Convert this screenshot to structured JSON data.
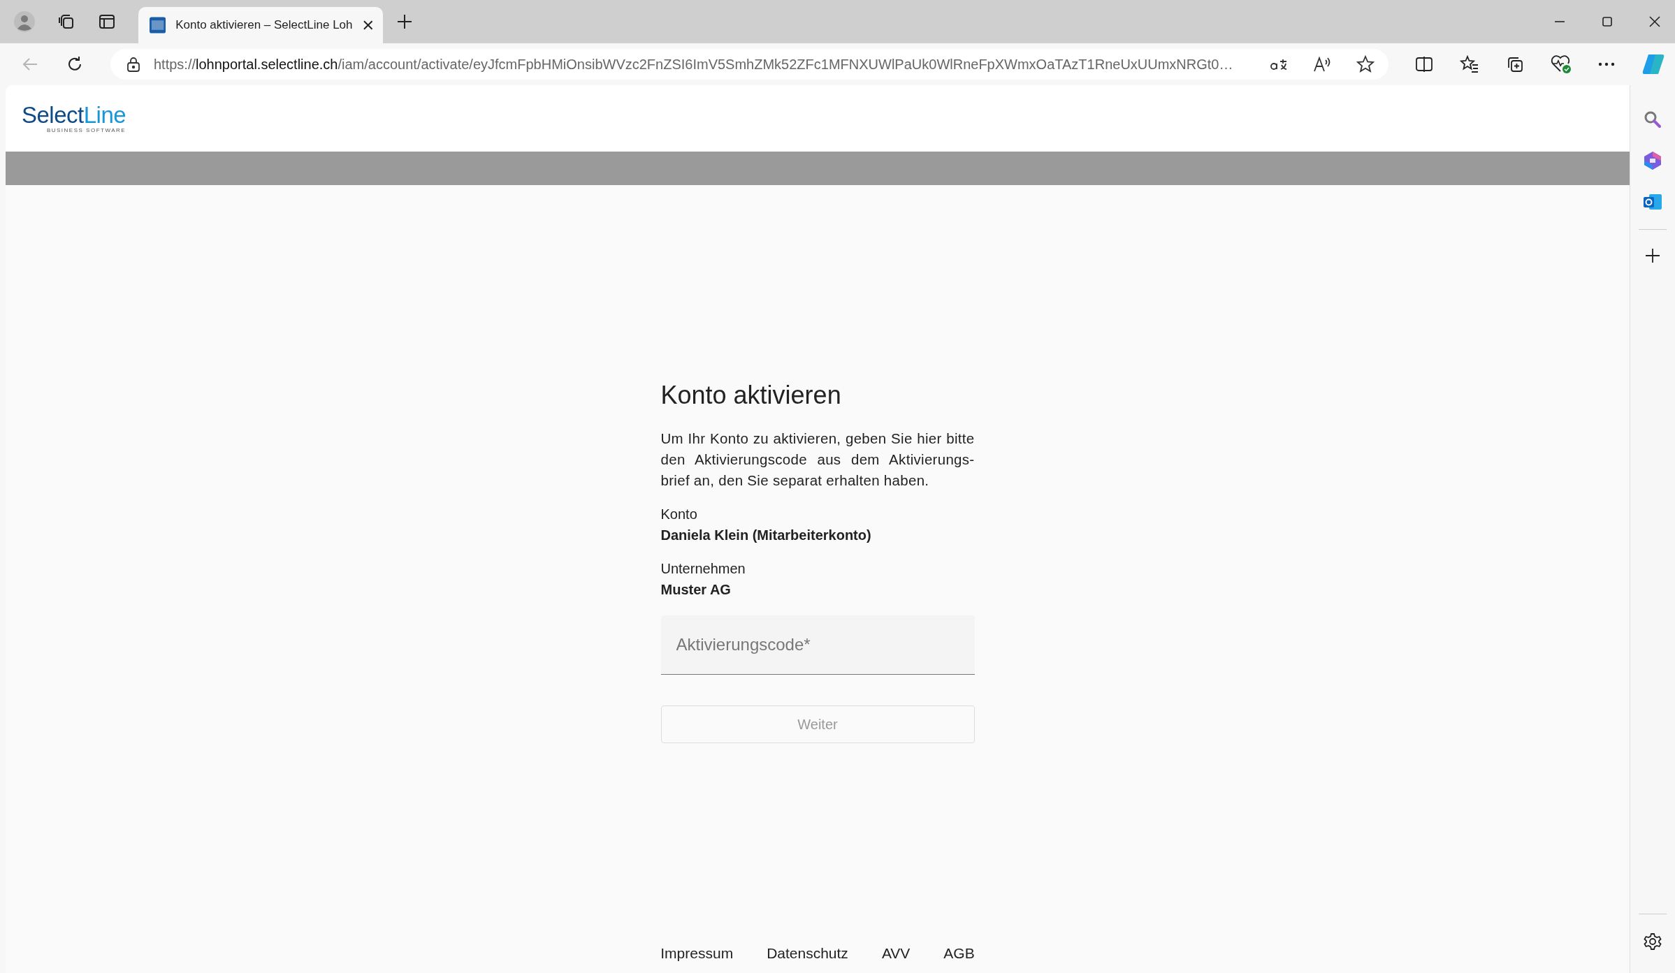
{
  "browser": {
    "tabs": [
      {
        "title": "Konto aktivieren – SelectLine Loh",
        "selected": true
      }
    ],
    "address": {
      "scheme": "https://",
      "host": "lohnportal.selectline.ch",
      "path": "/iam/account/activate/eyJfcmFpbHMiOnsibWVzc2FnZSI6ImV5SmhZMk52ZFc1MFNXUWlPaUk0WlRneFpXWmxOaTAzT1RneUxUUmxNRGt0…"
    }
  },
  "header": {
    "logo": {
      "primary": "Select",
      "accent": "Line",
      "tagline": "BUSINESS SOFTWARE"
    }
  },
  "form": {
    "title": "Konto aktivieren",
    "intro": "Um Ihr Konto zu aktivieren, geben Sie hier bitte den Aktivierungscode aus dem Aktivierungs-brief an, den Sie separat erhalten haben.",
    "details": [
      {
        "label": "Konto",
        "value": "Daniela Klein (Mitarbeiterkonto)"
      },
      {
        "label": "Unternehmen",
        "value": "Muster AG"
      }
    ],
    "code_field": {
      "placeholder": "Aktivierungscode*"
    },
    "submit": {
      "label": "Weiter",
      "disabled": true
    }
  },
  "footer": {
    "links": [
      "Impressum",
      "Datenschutz",
      "AVV",
      "AGB"
    ]
  }
}
